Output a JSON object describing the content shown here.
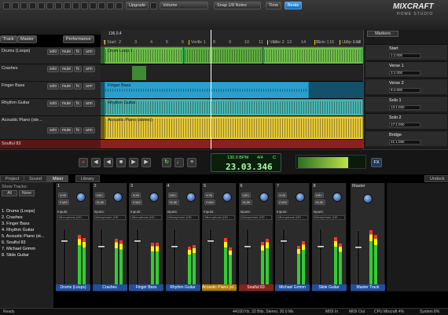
{
  "toolbar": {
    "upgrade_label": "Upgrade",
    "volume_select": "Volume",
    "snap_select": "Snap 1/8 Notes",
    "time_tab": "Time",
    "beats_tab": "Beats",
    "track_btn": "Track",
    "master_btn": "Master",
    "performance_btn": "Performance"
  },
  "logo": {
    "line1": "MIXCRAFT",
    "line2": "HOME STUDIO"
  },
  "ruler": {
    "position": "136.0.4",
    "bars": [
      "1",
      "2",
      "3",
      "4",
      "5",
      "6",
      "7",
      "8",
      "9",
      "10",
      "11",
      "12",
      "13",
      "14",
      "15",
      "16",
      "17",
      "18",
      "19",
      "20",
      "21",
      "22"
    ],
    "markers": [
      "Start",
      "Verse 1",
      "Verse 2",
      "Solo 1",
      "Loop End"
    ]
  },
  "tracks": [
    {
      "name": "Drums (Loops)",
      "clip": "Drum Loop 1",
      "color": "#6fbf4a"
    },
    {
      "name": "Crashes",
      "clip": "",
      "color": "#3f8a35"
    },
    {
      "name": "Finger Bass",
      "clip": "Finger Bass",
      "color": "#2a9fcc"
    },
    {
      "name": "Rhythm Guitar",
      "clip": "Rhythm Guitar",
      "color": "#4bb5b0"
    },
    {
      "name": "Acoustic Piano (ste...",
      "clip": "Acoustic Piano (stereo)",
      "color": "#e6c93c"
    },
    {
      "name": "Soulful 83",
      "clip": "",
      "color": "#b83333"
    }
  ],
  "track_buttons": {
    "solo": "solo",
    "mute": "mute",
    "arm": "arm",
    "fx": "fx"
  },
  "markers_panel": {
    "title": "Markers",
    "items": [
      {
        "name": "Start",
        "time": "1:1:000"
      },
      {
        "name": "Verse 1",
        "time": "3:1:000"
      },
      {
        "name": "Verse 2",
        "time": "9:1:000"
      },
      {
        "name": "Solo 1",
        "time": "13:1:000"
      },
      {
        "name": "Solo 2",
        "time": "17:1:000"
      },
      {
        "name": "Bridge",
        "time": "21:1:000"
      }
    ]
  },
  "transport": {
    "bpm": "130.0 BPM",
    "sig": "4/4",
    "key": "C",
    "time": "23.03.346",
    "fx": "FX"
  },
  "tabs": {
    "project": "Project",
    "sound": "Sound",
    "mixer": "Mixer",
    "library": "Library",
    "undock": "Undock"
  },
  "left_panel": {
    "title": "Show Tracks:",
    "all": "All",
    "none": "None",
    "items": [
      "1. Drums (Loops)",
      "2. Crashes",
      "3. Finger Bass",
      "4. Rhythm Guitar",
      "5. Acoustic Piano (st...",
      "6. Soulful 83",
      "7. Michael Grimm",
      "8. Slide Guitar"
    ]
  },
  "mixer": {
    "inputs_label": "Inputs:",
    "input_select": "Microphone (HD ...",
    "solo": "solo",
    "mute": "mute",
    "db_scale": [
      "0",
      "-6",
      "-12",
      "-18",
      "-24",
      "-30",
      "-40"
    ],
    "channels": [
      {
        "num": "1",
        "name": "Drums (Loops)",
        "color": "#1e4fa0"
      },
      {
        "num": "2",
        "name": "Crashes",
        "color": "#1e4fa0"
      },
      {
        "num": "3",
        "name": "Finger Bass",
        "color": "#1e4fa0"
      },
      {
        "num": "4",
        "name": "Rhythm Guitar",
        "color": "#1e4fa0"
      },
      {
        "num": "5",
        "name": "Acoustic Piano (st...",
        "color": "#b07a00"
      },
      {
        "num": "6",
        "name": "Soulful 83",
        "color": "#8a1f1f"
      },
      {
        "num": "7",
        "name": "Michael Grimm",
        "color": "#1e4fa0"
      },
      {
        "num": "8",
        "name": "Slide Guitar",
        "color": "#1e4fa0"
      }
    ],
    "master": {
      "title": "Master",
      "name": "Master Track"
    }
  },
  "status": {
    "left": "Ready",
    "format": "44100 Hz, 32 Bits, Stereo, 20.0 Ms",
    "midi_in": "MIDI In",
    "midi_out": "MIDI Out",
    "cpu": "CPU Mixcraft 4%",
    "system": "System 8%"
  },
  "colors": {
    "accent": "#2a8fe0",
    "record": "#d03030",
    "lcd": "#7cff7c"
  }
}
